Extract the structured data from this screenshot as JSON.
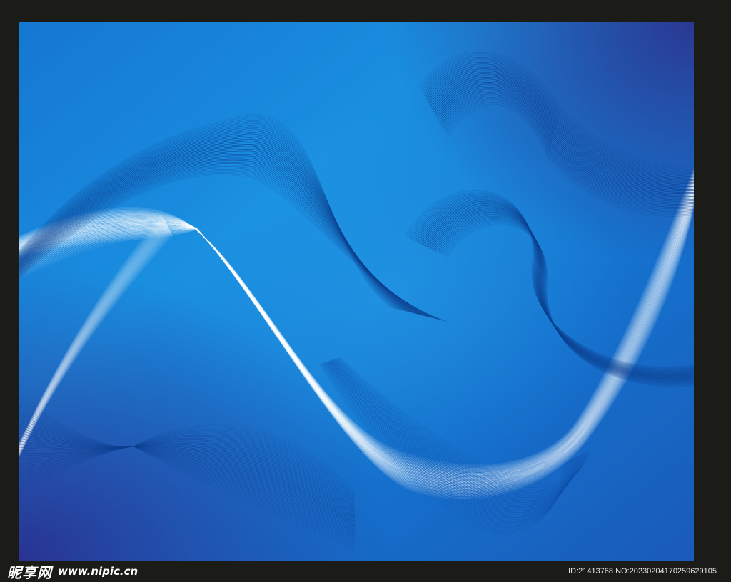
{
  "artwork": {
    "icon": "abstract-blue-wave-lines",
    "colors": {
      "frame": "#1b1b17",
      "bg_light": "#1a8fe0",
      "bg_mid": "#1468c4",
      "bg_dark": "#2a2c8e",
      "line_light": "#ffffff",
      "line_dark": "#0d3f8f"
    }
  },
  "watermark": {
    "brand_cn": "昵享网",
    "brand_url": "www.nipic.cn",
    "id_text": "ID:21413768 NO:20230204170259629105"
  }
}
